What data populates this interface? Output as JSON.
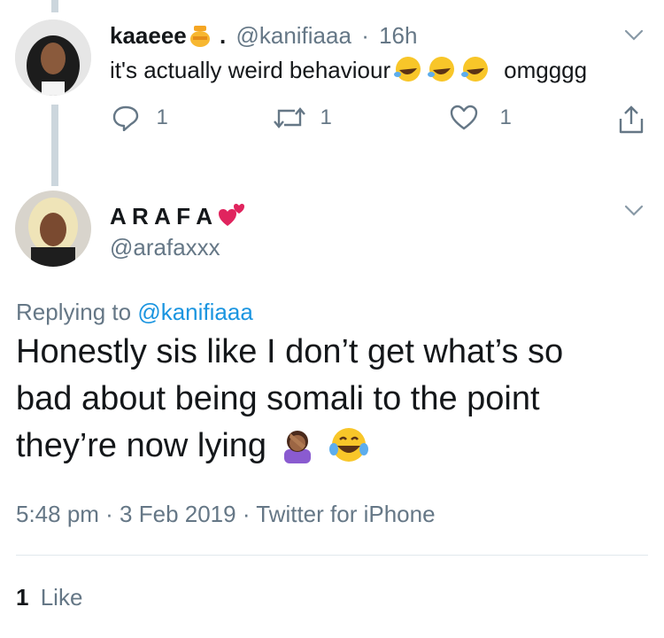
{
  "reply_tweet": {
    "display_name": "kaaeee",
    "handle": "@kanifiaaa",
    "separator": "·",
    "time": "16h",
    "text": "it's actually weird behaviour",
    "text_tail": "omgggg",
    "reply_count": "1",
    "retweet_count": "1",
    "like_count": "1"
  },
  "main_tweet": {
    "display_name": "A R A F A",
    "handle": "@arafaxxx",
    "replying_prefix": "Replying to",
    "replying_handle": "@kanifiaaa",
    "text_line1": "Honestly sis like I don’t get what’s so",
    "text_line2": "bad about being somali to the point",
    "text_line3": "they’re now lying",
    "timestamp": "5:48 pm · 3 Feb 2019 · Twitter for iPhone",
    "likes_count": "1",
    "likes_label": "Like"
  },
  "colors": {
    "text_primary": "#14171a",
    "text_secondary": "#657786",
    "link": "#1b95e0",
    "thread_line": "#ccd6dd"
  }
}
